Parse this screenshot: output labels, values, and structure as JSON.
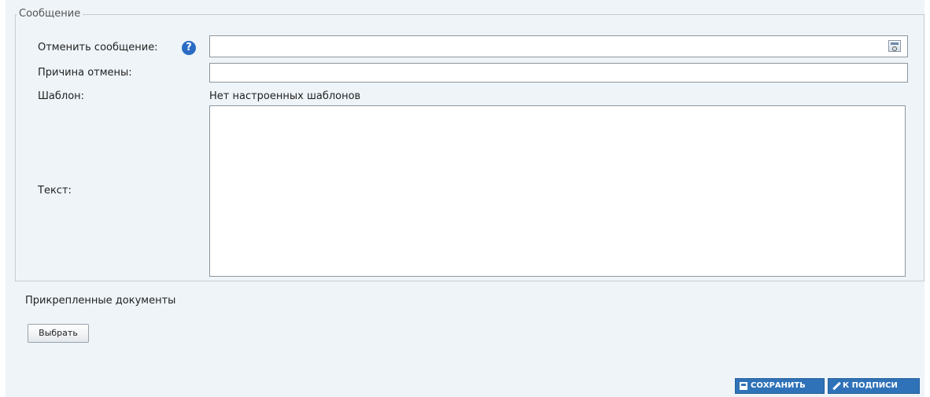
{
  "form": {
    "legend": "Сообщение",
    "cancel_message_label": "Отменить сообщение:",
    "cancel_message_value": "",
    "help_icon_glyph": "?",
    "reason_label": "Причина отмены:",
    "reason_value": "",
    "template_label": "Шаблон:",
    "template_value": "Нет настроенных шаблонов",
    "text_label": "Текст:",
    "text_value": ""
  },
  "attachments": {
    "label": "Прикрепленные документы",
    "choose_button": "Выбрать"
  },
  "actions": {
    "save_label": "СОХРАНИТЬ",
    "sign_label": "К ПОДПИСИ"
  },
  "icons": {
    "help": "help-icon",
    "lookup": "lookup-icon",
    "save": "save-icon",
    "pen": "pen-icon"
  },
  "colors": {
    "panel_background": "#eef4f8",
    "help_icon": "#2a6bc4",
    "action_button": "#2f72b8"
  }
}
